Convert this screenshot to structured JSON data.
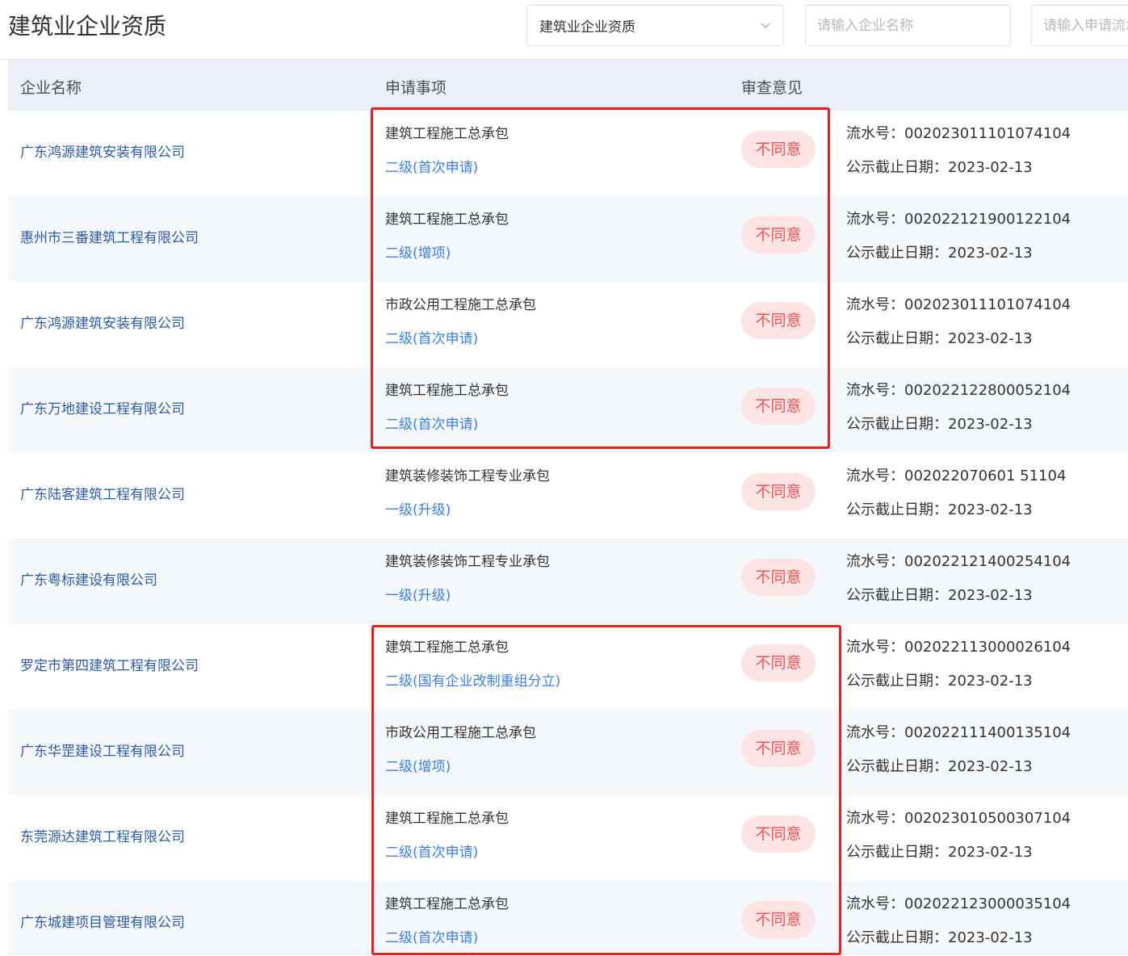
{
  "page": {
    "title": "建筑业企业资质"
  },
  "filters": {
    "type_select_value": "建筑业企业资质",
    "company_placeholder": "请输入企业名称",
    "serial_placeholder": "请输入申请流水号"
  },
  "table": {
    "headers": [
      "企业名称",
      "申请事项",
      "审查意见"
    ],
    "rows": [
      {
        "company": "广东鸿源建筑安装有限公司",
        "item": "建筑工程施工总承包",
        "level": "二级(首次申请)",
        "opinion": "不同意",
        "serial": "流水号：002023011101074104",
        "deadline": "公示截止日期：2023-02-13"
      },
      {
        "company": "惠州市三番建筑工程有限公司",
        "item": "建筑工程施工总承包",
        "level": "二级(增项)",
        "opinion": "不同意",
        "serial": "流水号：002022121900122104",
        "deadline": "公示截止日期：2023-02-13"
      },
      {
        "company": "广东鸿源建筑安装有限公司",
        "item": "市政公用工程施工总承包",
        "level": "二级(首次申请)",
        "opinion": "不同意",
        "serial": "流水号：002023011101074104",
        "deadline": "公示截止日期：2023-02-13"
      },
      {
        "company": "广东万地建设工程有限公司",
        "item": "建筑工程施工总承包",
        "level": "二级(首次申请)",
        "opinion": "不同意",
        "serial": "流水号：002022122800052104",
        "deadline": "公示截止日期：2023-02-13"
      },
      {
        "company": "广东陆客建筑工程有限公司",
        "item": "建筑装修装饰工程专业承包",
        "level": "一级(升级)",
        "opinion": "不同意",
        "serial": "流水号：002022070601 51104",
        "deadline": "公示截止日期：2023-02-13"
      },
      {
        "company": "广东粤标建设有限公司",
        "item": "建筑装修装饰工程专业承包",
        "level": "一级(升级)",
        "opinion": "不同意",
        "serial": "流水号：002022121400254104",
        "deadline": "公示截止日期：2023-02-13"
      },
      {
        "company": "罗定市第四建筑工程有限公司",
        "item": "建筑工程施工总承包",
        "level": "二级(国有企业改制重组分立)",
        "opinion": "不同意",
        "serial": "流水号：002022113000026104",
        "deadline": "公示截止日期：2023-02-13"
      },
      {
        "company": "广东华罡建设工程有限公司",
        "item": "市政公用工程施工总承包",
        "level": "二级(增项)",
        "opinion": "不同意",
        "serial": "流水号：002022111400135104",
        "deadline": "公示截止日期：2023-02-13"
      },
      {
        "company": "东莞源达建筑工程有限公司",
        "item": "建筑工程施工总承包",
        "level": "二级(首次申请)",
        "opinion": "不同意",
        "serial": "流水号：002023010500307104",
        "deadline": "公示截止日期：2023-02-13"
      },
      {
        "company": "广东城建项目管理有限公司",
        "item": "建筑工程施工总承包",
        "level": "二级(首次申请)",
        "opinion": "不同意",
        "serial": "流水号：002022123000035104",
        "deadline": "公示截止日期：2023-02-13"
      }
    ]
  },
  "colors": {
    "highlight_border": "#ee1c1c",
    "opinion_bg": "#fde4e4",
    "opinion_text": "#f05252",
    "company_link": "#2a5aa8",
    "level_link": "#3a7ee8"
  }
}
